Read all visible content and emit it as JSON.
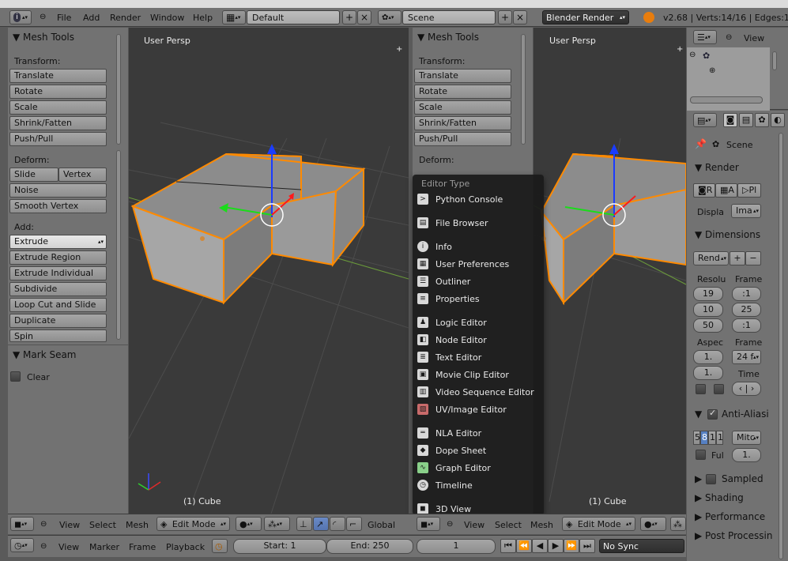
{
  "topbar": {
    "menus": [
      "File",
      "Add",
      "Render",
      "Window",
      "Help"
    ],
    "layout_name": "Default",
    "scene_name": "Scene",
    "engine": "Blender Render",
    "stats": "v2.68 | Verts:14/16 | Edges:1:"
  },
  "left_tools": {
    "title": "Mesh Tools",
    "transform_label": "Transform:",
    "transform": [
      "Translate",
      "Rotate",
      "Scale",
      "Shrink/Fatten",
      "Push/Pull"
    ],
    "deform_label": "Deform:",
    "deform_row": [
      "Slide Edge",
      "Vertex"
    ],
    "deform": [
      "Noise",
      "Smooth Vertex"
    ],
    "add_label": "Add:",
    "add": [
      "Extrude",
      "Extrude Region",
      "Extrude Individual",
      "Subdivide",
      "Loop Cut and Slide",
      "Duplicate",
      "Spin"
    ],
    "mark_seam_title": "Mark Seam",
    "clear_label": "Clear"
  },
  "right_tools": {
    "title": "Mesh Tools",
    "transform_label": "Transform:",
    "transform": [
      "Translate",
      "Rotate",
      "Scale",
      "Shrink/Fatten",
      "Push/Pull"
    ],
    "deform_label": "Deform:"
  },
  "viewport_left": {
    "persp_label": "User Persp",
    "object_label": "(1) Cube"
  },
  "viewport_right": {
    "persp_label": "User Persp",
    "object_label": "(1) Cube"
  },
  "header3d": {
    "menus": [
      "View",
      "Select",
      "Mesh"
    ],
    "mode": "Edit Mode",
    "orientation": "Global"
  },
  "header3d_right": {
    "menus": [
      "View",
      "Select",
      "Mesh"
    ],
    "mode": "Edit Mode"
  },
  "timeline": {
    "menus": [
      "View",
      "Marker",
      "Frame",
      "Playback"
    ],
    "start": "Start: 1",
    "end": "End: 250",
    "current": "1",
    "sync": "No Sync"
  },
  "editor_menu": {
    "title": "Editor Type",
    "items": [
      {
        "label": "Python Console",
        "icon": "python-console-icon"
      },
      {
        "label": "File Browser",
        "icon": "file-browser-icon"
      },
      {
        "label": "Info",
        "icon": "info-icon"
      },
      {
        "label": "User Preferences",
        "icon": "preferences-icon"
      },
      {
        "label": "Outliner",
        "icon": "outliner-icon"
      },
      {
        "label": "Properties",
        "icon": "properties-icon"
      },
      {
        "label": "Logic Editor",
        "icon": "logic-editor-icon"
      },
      {
        "label": "Node Editor",
        "icon": "node-editor-icon"
      },
      {
        "label": "Text Editor",
        "icon": "text-editor-icon"
      },
      {
        "label": "Movie Clip Editor",
        "icon": "movie-clip-icon"
      },
      {
        "label": "Video Sequence Editor",
        "icon": "sequencer-icon"
      },
      {
        "label": "UV/Image Editor",
        "icon": "image-editor-icon"
      },
      {
        "label": "NLA Editor",
        "icon": "nla-editor-icon"
      },
      {
        "label": "Dope Sheet",
        "icon": "dope-sheet-icon"
      },
      {
        "label": "Graph Editor",
        "icon": "graph-editor-icon"
      },
      {
        "label": "Timeline",
        "icon": "timeline-icon"
      },
      {
        "label": "3D View",
        "icon": "view3d-icon"
      }
    ]
  },
  "outliner": {
    "view_label": "View"
  },
  "properties": {
    "scene": "Scene",
    "render_title": "Render",
    "render_buttons": [
      "R",
      "A",
      "Pl"
    ],
    "display_label": "Displa",
    "display_value": "Ima",
    "dimensions_title": "Dimensions",
    "preset_value": "Rend",
    "resolution_label": "Resolu",
    "frame_label": "Frame",
    "res_values": [
      "19",
      "10",
      "50"
    ],
    "frame_values": [
      ":1",
      "25",
      ":1"
    ],
    "aspect_label": "Aspec",
    "frame_rate_label": "Frame",
    "aspect_values": [
      "1.",
      "1."
    ],
    "fps_value": "24 f",
    "time_label": "Time",
    "aa_title": "Anti-Aliasi",
    "aa_samples": [
      "5",
      "8",
      "1",
      "1"
    ],
    "filter_value": "Mitc",
    "full_label": "Ful",
    "full_value": "1.",
    "collapsed": [
      "Sampled",
      "Shading",
      "Performance",
      "Post Processin"
    ]
  }
}
